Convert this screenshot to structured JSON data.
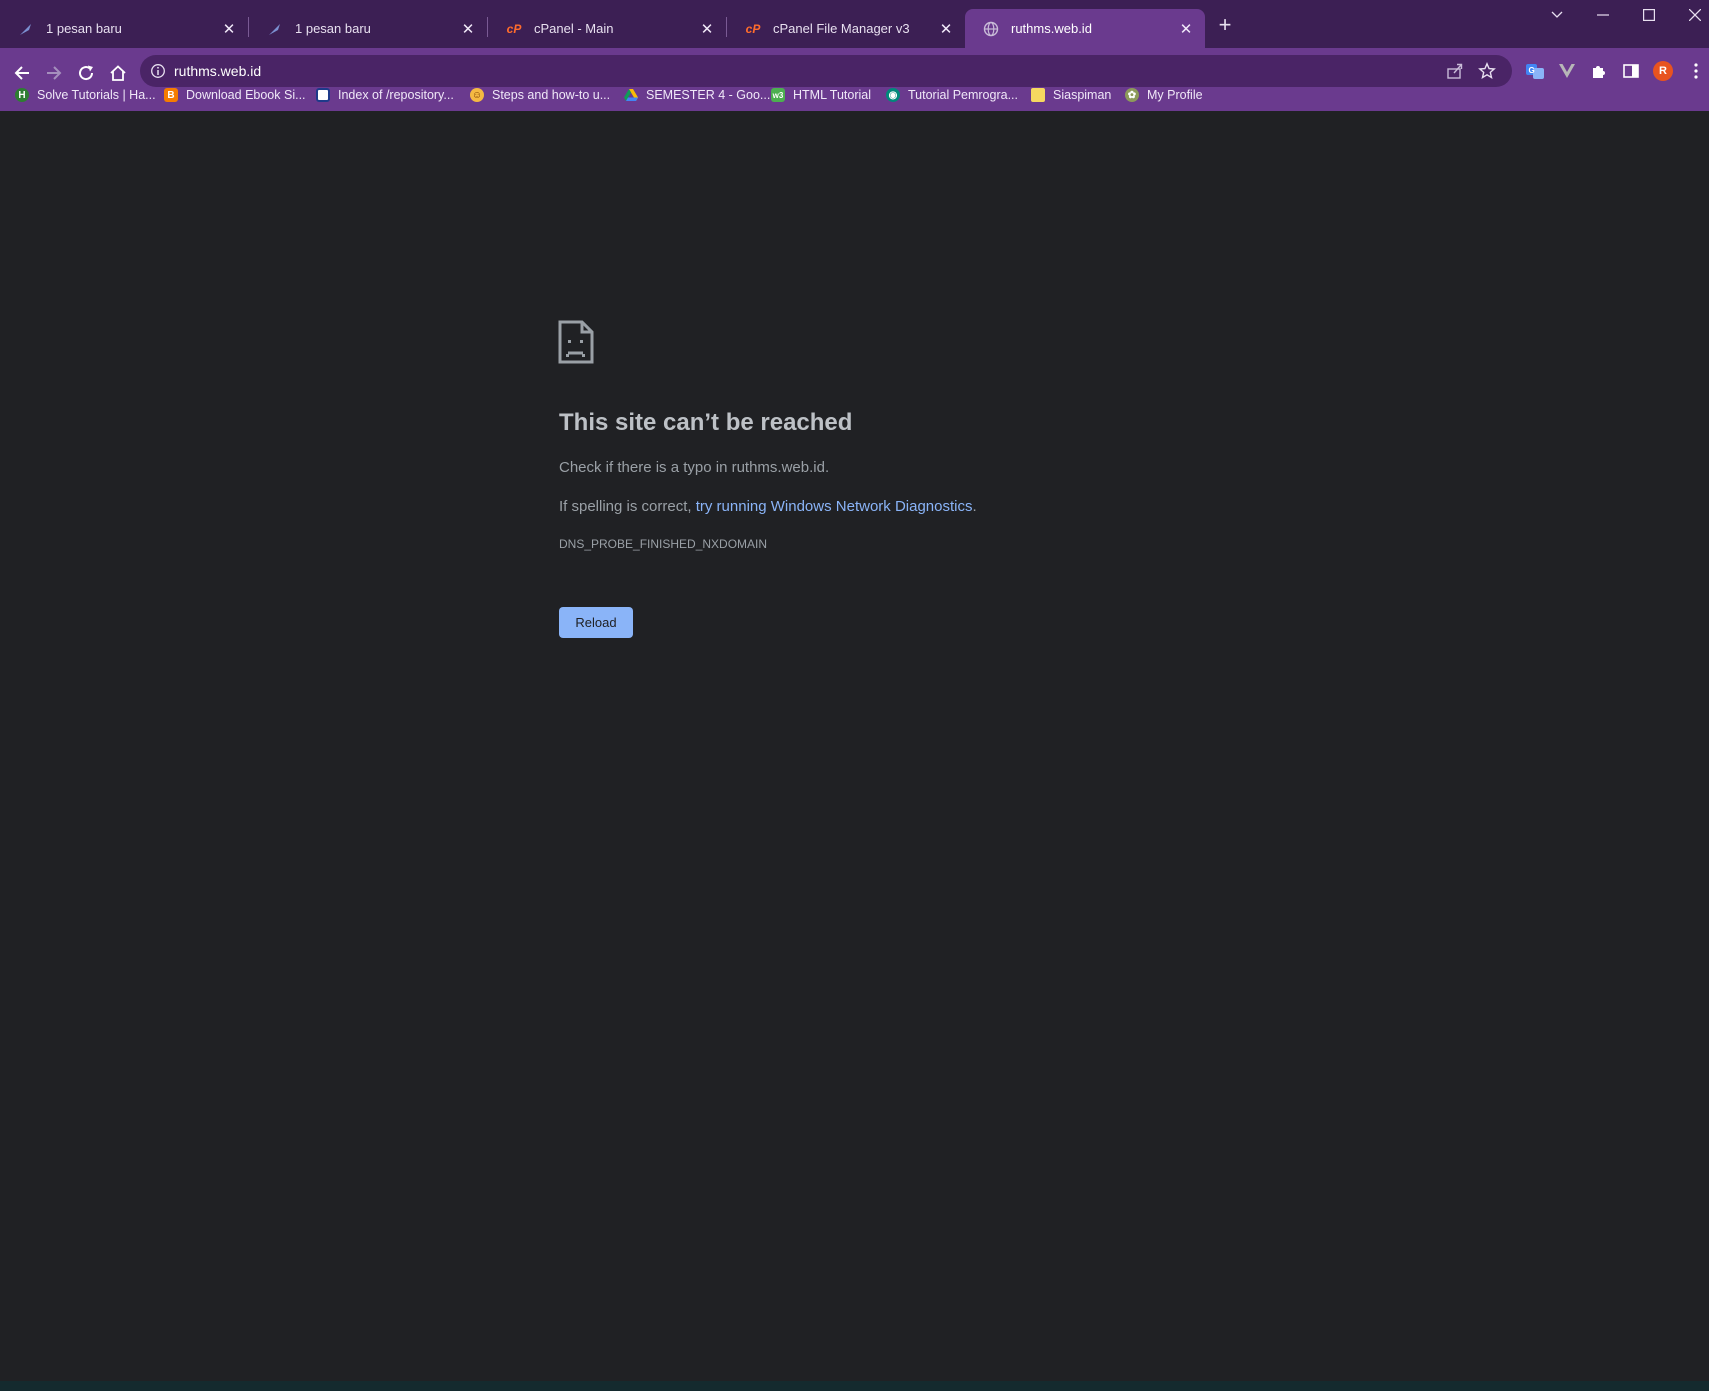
{
  "tabs": [
    {
      "title": "1 pesan baru",
      "icon": "feather-icon",
      "active": false
    },
    {
      "title": "1 pesan baru",
      "icon": "feather-icon",
      "active": false
    },
    {
      "title": "cPanel - Main",
      "icon": "cpanel-icon",
      "active": false
    },
    {
      "title": "cPanel File Manager v3",
      "icon": "cpanel-icon",
      "active": false
    },
    {
      "title": "ruthms.web.id",
      "icon": "globe-icon",
      "active": true
    }
  ],
  "omnibox": {
    "url": "ruthms.web.id"
  },
  "bookmarks": [
    {
      "label": "Solve Tutorials | Ha...",
      "icon": "h-icon",
      "color": "#2e7d32"
    },
    {
      "label": "Download Ebook Si...",
      "icon": "blogger-icon",
      "color": "#f57c00"
    },
    {
      "label": "Index of /repository...",
      "icon": "page-icon",
      "color": "#1e3a8a"
    },
    {
      "label": "Steps and how-to u...",
      "icon": "emoji-icon",
      "color": "#f5b942"
    },
    {
      "label": "SEMESTER 4 - Goo...",
      "icon": "drive-icon",
      "color": "#1e88e5"
    },
    {
      "label": "HTML Tutorial",
      "icon": "w3-icon",
      "color": "#4caf50"
    },
    {
      "label": "Tutorial Pemrogra...",
      "icon": "circle-logo-icon",
      "color": "#00897b"
    },
    {
      "label": "Siaspiman",
      "icon": "folder-icon",
      "color": "#f6d860"
    },
    {
      "label": "My Profile",
      "icon": "profile-logo-icon",
      "color": "#8d9a5a"
    }
  ],
  "profile": {
    "initial": "R",
    "color": "#e8531f"
  },
  "error": {
    "title": "This site can’t be reached",
    "line1": "Check if there is a typo in ruthms.web.id.",
    "line2_prefix": "If spelling is correct, ",
    "line2_link": "try running Windows Network Diagnostics",
    "line2_suffix": ".",
    "code": "DNS_PROBE_FINISHED_NXDOMAIN",
    "reload_label": "Reload"
  },
  "colors": {
    "frame": "#3c1f54",
    "toolbar": "#6a3a8e",
    "page_bg": "#202124",
    "link": "#8ab4f8"
  }
}
